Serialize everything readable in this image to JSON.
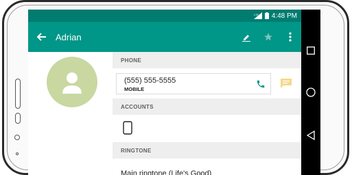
{
  "status_bar": {
    "time": "4:48 PM",
    "icons": [
      "lte-signal-icon",
      "battery-icon"
    ]
  },
  "app_bar": {
    "title": "Adrian",
    "back_icon": "arrow-left-icon",
    "actions": [
      "edit-icon",
      "star-icon",
      "more-vert-icon"
    ]
  },
  "contact": {
    "avatar_icon": "person-silhouette-icon"
  },
  "sections": {
    "phone_header": "PHONE",
    "accounts_header": "ACCOUNTS",
    "ringtone_header": "RINGTONE"
  },
  "phone": {
    "number": "(555) 555-5555",
    "type": "MOBILE",
    "call_icon": "phone-icon",
    "message_icon": "message-icon"
  },
  "accounts": {
    "device_icon": "smartphone-icon"
  },
  "ringtone": {
    "value": "Main ringtone (Life's Good)"
  },
  "nav_bar": {
    "buttons": [
      "recents-square-icon",
      "home-circle-icon",
      "back-triangle-icon"
    ]
  },
  "colors": {
    "status_bar": "#007c70",
    "app_bar": "#009688",
    "avatar_bg": "#c8d8a0",
    "section_header_bg": "#eeeeee",
    "call_icon": "#009688",
    "message_icon": "#f5d98a"
  }
}
